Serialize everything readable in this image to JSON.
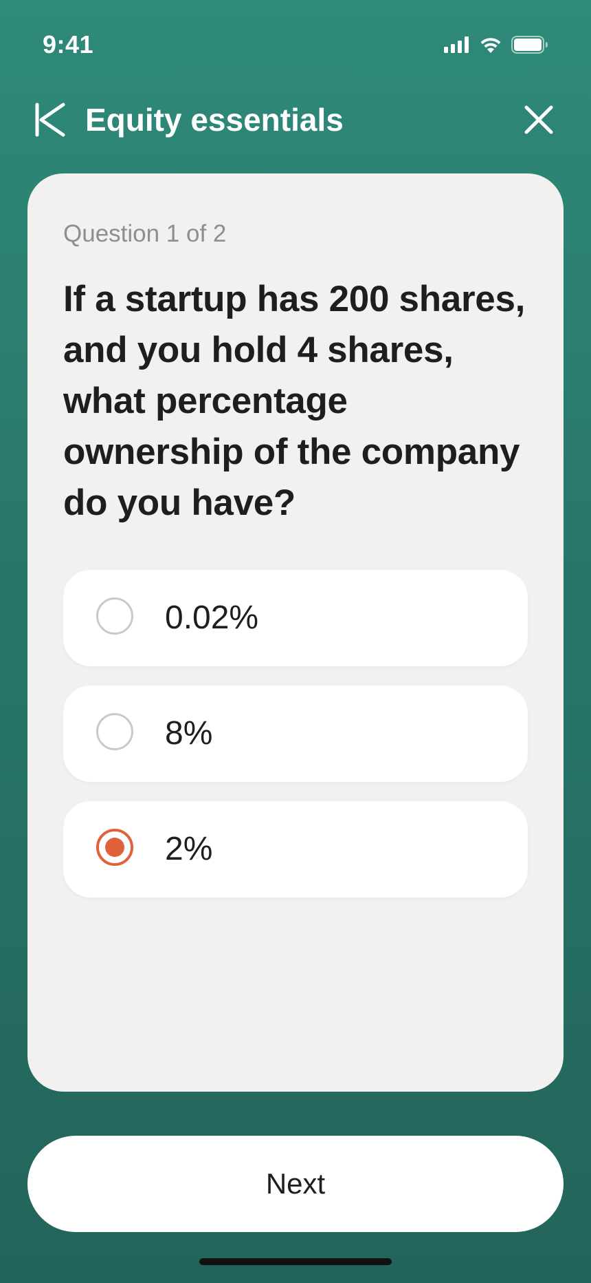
{
  "status_bar": {
    "time": "9:41",
    "icons": [
      "cellular-signal-icon",
      "wifi-icon",
      "battery-icon"
    ]
  },
  "header": {
    "title": "Equity essentials",
    "back_icon": "back-chevron-icon",
    "close_icon": "close-icon"
  },
  "quiz": {
    "counter": "Question 1 of 2",
    "question": "If a startup has 200 shares, and you hold 4 shares, what percentage ownership of the company do you have?",
    "options": [
      {
        "label": "0.02%",
        "selected": false
      },
      {
        "label": "8%",
        "selected": false
      },
      {
        "label": "2%",
        "selected": true
      }
    ]
  },
  "footer": {
    "next_label": "Next"
  },
  "colors": {
    "background_top": "#2f8a7a",
    "background_bottom": "#23645a",
    "card": "#f2f1ef",
    "accent": "#e0623a",
    "text": "#1e1e1e",
    "muted_text": "#8e8e8e"
  }
}
